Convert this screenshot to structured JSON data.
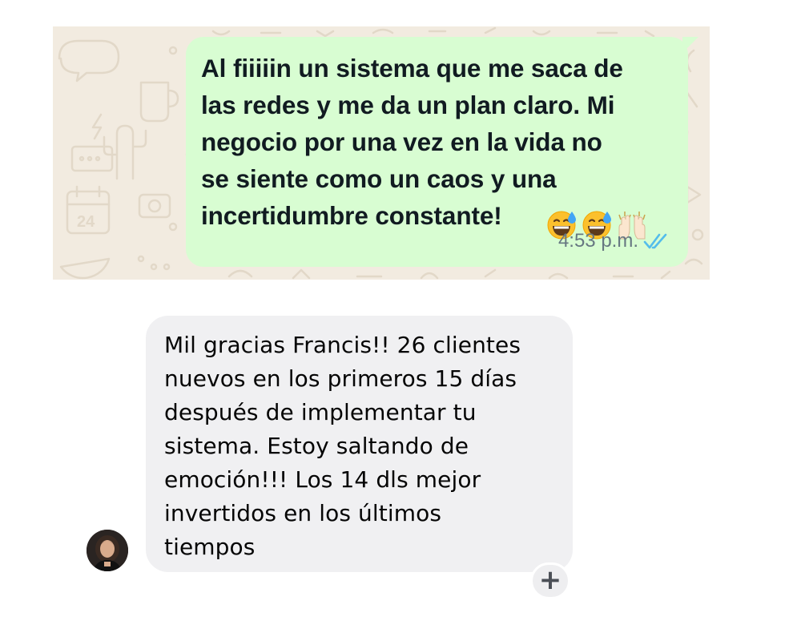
{
  "whatsapp": {
    "message_text": "Al fiiiiin un sistema que me saca de\nlas redes y me da un plan claro. Mi\nnegocio por una vez en la vida no\nse siente como un caos y una\nincertidumbre constante!",
    "emojis": [
      "grinning-sweat-emoji",
      "grinning-sweat-emoji",
      "raising-hands-emoji"
    ],
    "time": "4:53 p.m.",
    "read_status": "read-double-check",
    "colors": {
      "bubble": "#d8fdd2",
      "background": "#f2ebe0",
      "ticks": "#53bdeb",
      "time": "#667781"
    }
  },
  "messenger": {
    "message_text": "Mil gracias Francis!! 26 clientes\nnuevos en los primeros 15 días\ndespués de implementar tu\nsistema. Estoy saltando de\nemoción!!! Los 14 dls mejor\ninvertidos en los últimos\ntiempos",
    "react_button_label": "+",
    "colors": {
      "bubble": "#f0f0f2",
      "text": "#050505"
    }
  }
}
